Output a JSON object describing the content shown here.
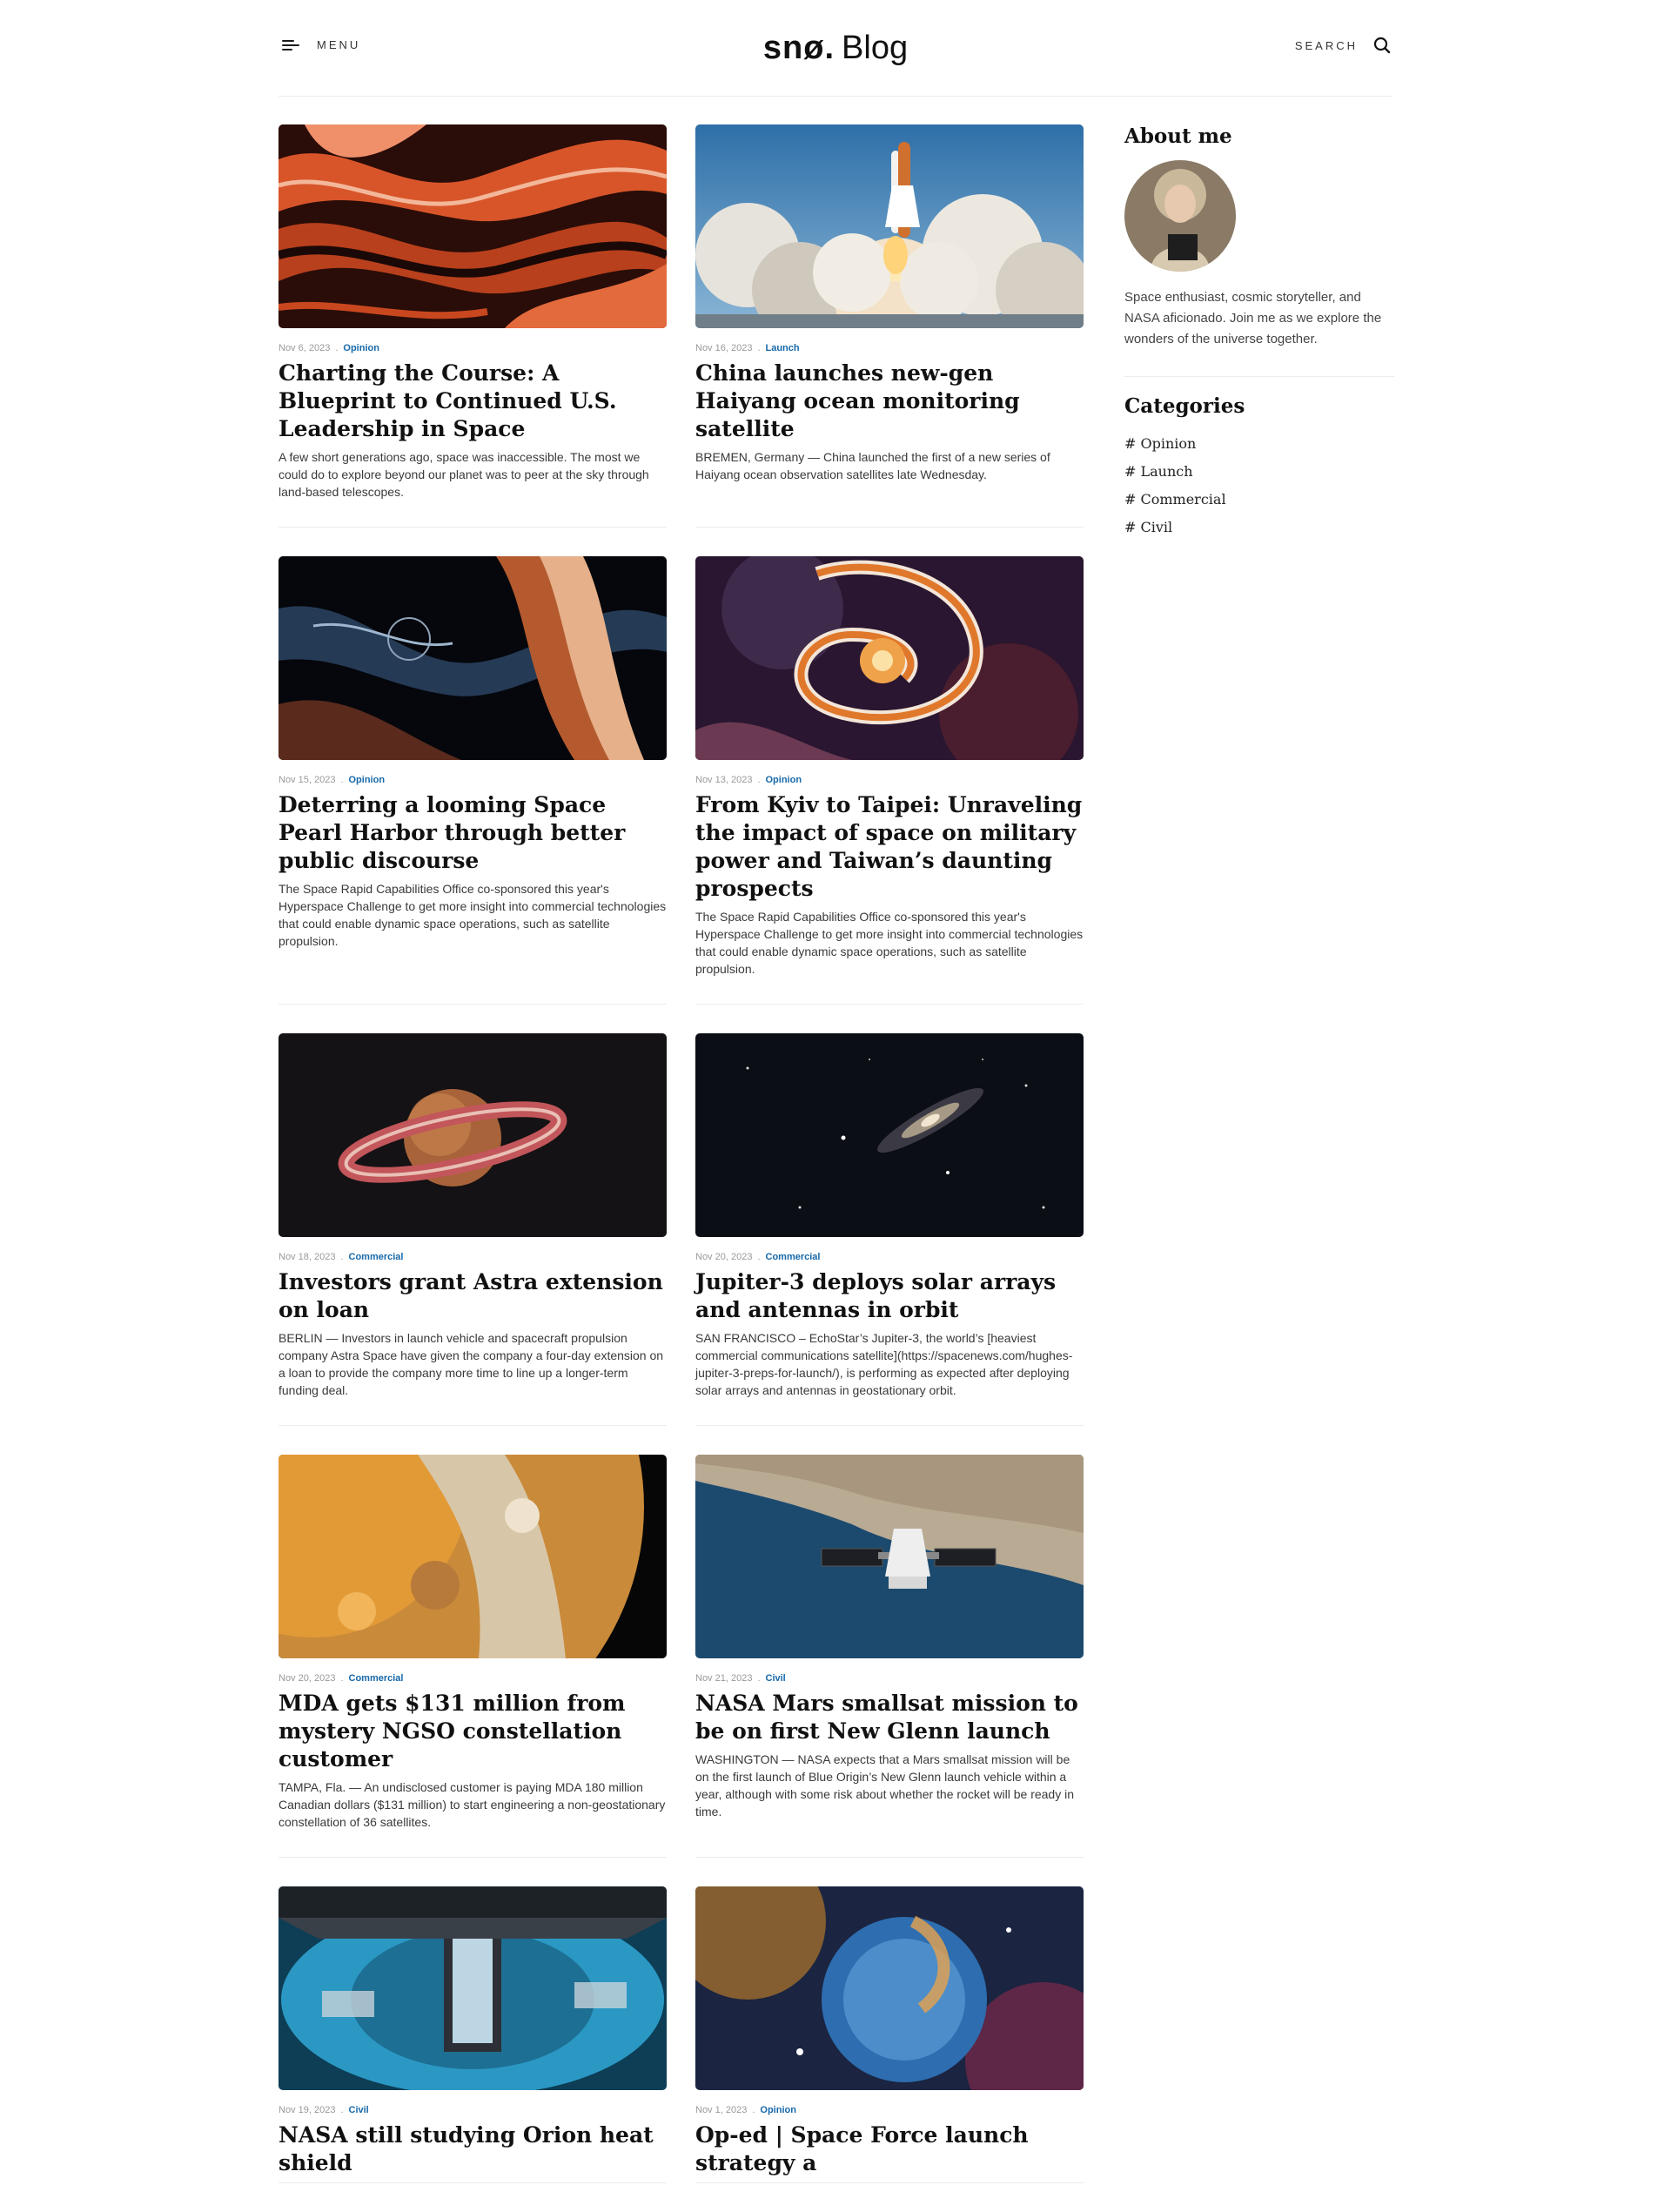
{
  "header": {
    "menu_label": "MENU",
    "logo_brand": "snø.",
    "logo_blog": "Blog",
    "search_label": "SEARCH"
  },
  "posts": [
    {
      "date": "Nov 6, 2023",
      "category": "Opinion",
      "title": "Charting the Course: A Blueprint to Continued U.S. Leadership in Space",
      "excerpt": "A few short generations ago, space was inaccessible. The most we could do to explore beyond our planet was to peer at the sky through land-based telescopes."
    },
    {
      "date": "Nov 16, 2023",
      "category": "Launch",
      "title": "China launches new-gen Haiyang ocean monitoring satellite",
      "excerpt": "BREMEN, Germany — China launched the first of a new series of Haiyang ocean observation satellites late Wednesday."
    },
    {
      "date": "Nov 15, 2023",
      "category": "Opinion",
      "title": "Deterring a looming Space Pearl Harbor through better public discourse",
      "excerpt": "The Space Rapid Capabilities Office co-sponsored this year's Hyperspace Challenge to get more insight into commercial technologies that could enable dynamic space operations, such as satellite propulsion."
    },
    {
      "date": "Nov 13, 2023",
      "category": "Opinion",
      "title": "From Kyiv to Taipei: Unraveling the impact of space on military power and Taiwan’s daunting prospects",
      "excerpt": "The Space Rapid Capabilities Office co-sponsored this year's Hyperspace Challenge to get more insight into commercial technologies that could enable dynamic space operations, such as satellite propulsion."
    },
    {
      "date": "Nov 18, 2023",
      "category": "Commercial",
      "title": "Investors grant Astra extension on loan",
      "excerpt": "BERLIN — Investors in launch vehicle and spacecraft propulsion company Astra Space have given the company a four-day extension on a loan to provide the company more time to line up a longer-term funding deal."
    },
    {
      "date": "Nov 20, 2023",
      "category": "Commercial",
      "title": "Jupiter-3 deploys solar arrays and antennas in orbit",
      "excerpt": "SAN FRANCISCO – EchoStar’s Jupiter-3, the world’s [heaviest commercial communications satellite](https://spacenews.com/hughes-jupiter-3-preps-for-launch/), is performing as expected after deploying solar arrays and antennas in geostationary orbit."
    },
    {
      "date": "Nov 20, 2023",
      "category": "Commercial",
      "title": "MDA gets $131 million from mystery NGSO constellation customer",
      "excerpt": "TAMPA, Fla. — An undisclosed customer is paying MDA 180 million Canadian dollars ($131 million) to start engineering a non-geostationary constellation of 36 satellites."
    },
    {
      "date": "Nov 21, 2023",
      "category": "Civil",
      "title": "NASA Mars smallsat mission to be on first New Glenn launch",
      "excerpt": "WASHINGTON — NASA expects that a Mars smallsat mission will be on the first launch of Blue Origin’s New Glenn launch vehicle within a year, although with some risk about whether the rocket will be ready in time."
    },
    {
      "date": "Nov 19, 2023",
      "category": "Civil",
      "title": "NASA still studying Orion heat shield",
      "excerpt": ""
    },
    {
      "date": "Nov 1, 2023",
      "category": "Opinion",
      "title": "Op-ed | Space Force launch strategy a",
      "excerpt": ""
    }
  ],
  "sidebar": {
    "about_heading": "About me",
    "about_text": "Space enthusiast, cosmic storyteller, and NASA aficionado. Join me as we explore the wonders of the universe together.",
    "categories_heading": "Categories",
    "categories": [
      "# Opinion",
      "# Launch",
      "# Commercial",
      "# Civil"
    ]
  }
}
